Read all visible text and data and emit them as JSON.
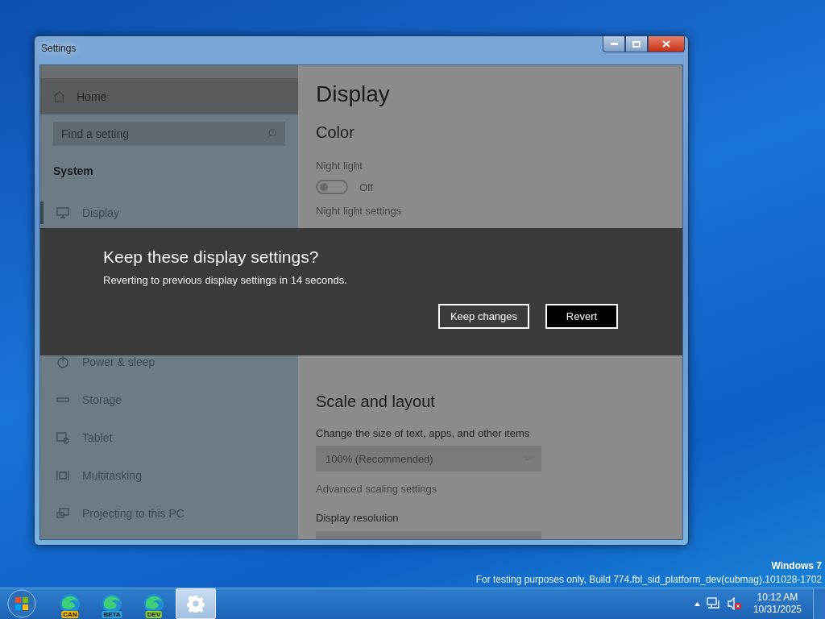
{
  "window": {
    "title": "Settings"
  },
  "sidebar": {
    "home": {
      "label": "Home"
    },
    "search": {
      "placeholder": "Find a setting"
    },
    "section": "System",
    "items_top": [
      {
        "label": "Display",
        "selected": true,
        "kind": "display"
      }
    ],
    "items_bottom": [
      {
        "label": "Power & sleep",
        "selected": false,
        "kind": "power"
      },
      {
        "label": "Storage",
        "selected": false,
        "kind": "storage"
      },
      {
        "label": "Tablet",
        "selected": false,
        "kind": "tablet"
      },
      {
        "label": "Multitasking",
        "selected": false,
        "kind": "multitasking"
      },
      {
        "label": "Projecting to this PC",
        "selected": false,
        "kind": "projecting"
      }
    ]
  },
  "content": {
    "title": "Display",
    "color_section": {
      "heading": "Color",
      "night_light": {
        "label": "Night light",
        "on": false,
        "state_text": "Off"
      },
      "link": "Night light settings"
    },
    "scale_section": {
      "heading": "Scale and layout",
      "size_label": "Change the size of text, apps, and other items",
      "size_value": "100% (Recommended)",
      "link": "Advanced scaling settings",
      "resolution_label": "Display resolution"
    }
  },
  "dialog": {
    "title": "Keep these display settings?",
    "message": "Reverting to previous display settings in 14 seconds.",
    "buttons": [
      {
        "label": "Keep changes",
        "kind": "secondary"
      },
      {
        "label": "Revert",
        "kind": "primary"
      }
    ]
  },
  "desktop": {
    "os_name": "Windows 7",
    "build_note": "For testing purposes only, Build 774.fbl_sid_platform_dev(cubmag).101028-1702"
  },
  "taskbar": {
    "apps": [
      {
        "kind": "browser",
        "badge": "CAN",
        "color": "#f0b400",
        "selected": false
      },
      {
        "kind": "browser",
        "badge": "BETA",
        "color": "#2aa0d8",
        "selected": false
      },
      {
        "kind": "browser",
        "badge": "DEV",
        "color": "#8ccf2a",
        "selected": false
      },
      {
        "kind": "settings",
        "selected": true
      }
    ],
    "time": "10:12 AM",
    "date": "10/31/2025"
  }
}
